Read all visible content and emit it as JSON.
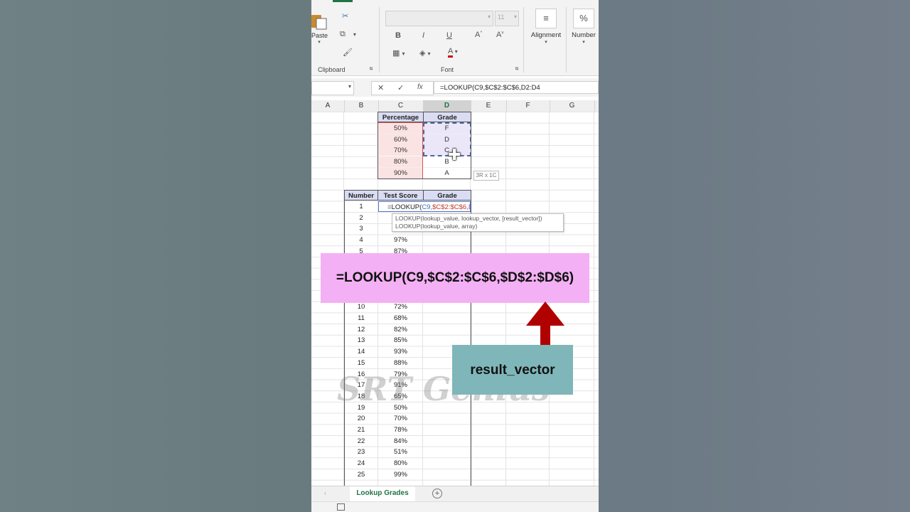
{
  "ribbon": {
    "clipboard_label": "Clipboard",
    "paste_label": "Paste",
    "font_label": "Font",
    "font_size": "11",
    "bold": "B",
    "italic": "I",
    "underline": "U",
    "alignment_label": "Alignment",
    "number_label": "Number",
    "percent_symbol": "%"
  },
  "formula_bar": {
    "formula": "=LOOKUP(C9,$C$2:$C$6,D2:D4"
  },
  "columns": [
    "A",
    "B",
    "C",
    "D",
    "E",
    "F",
    "G"
  ],
  "lookup_table": {
    "headers": [
      "Percentage",
      "Grade"
    ],
    "percentages": [
      "50%",
      "60%",
      "70%",
      "80%",
      "90%"
    ],
    "grades": [
      "F",
      "D",
      "C",
      "B",
      "A"
    ],
    "selection_hint": "3R x 1C"
  },
  "score_table": {
    "headers": [
      "Number",
      "Test Score",
      "Grade"
    ],
    "edit_cell": {
      "prefix": "=LOOKUP(",
      "arg1": "C9,",
      "arg2": "$C$2:$C$6,",
      "arg3": "D2:D4"
    },
    "tooltip": {
      "line1": "LOOKUP(lookup_value, lookup_vector, [result_vector])",
      "line2": "LOOKUP(lookup_value, array)"
    },
    "rows_top": [
      {
        "n": "1",
        "s": ""
      },
      {
        "n": "2",
        "s": ""
      },
      {
        "n": "3",
        "s": ""
      },
      {
        "n": "4",
        "s": "97%"
      },
      {
        "n": "5",
        "s": "87%"
      }
    ],
    "rows_bottom": [
      {
        "n": "10",
        "s": "72%"
      },
      {
        "n": "11",
        "s": "68%"
      },
      {
        "n": "12",
        "s": "82%"
      },
      {
        "n": "13",
        "s": "85%"
      },
      {
        "n": "14",
        "s": "93%"
      },
      {
        "n": "15",
        "s": "88%"
      },
      {
        "n": "16",
        "s": "79%"
      },
      {
        "n": "17",
        "s": "91%"
      },
      {
        "n": "18",
        "s": "65%"
      },
      {
        "n": "19",
        "s": "50%"
      },
      {
        "n": "20",
        "s": "70%"
      },
      {
        "n": "21",
        "s": "78%"
      },
      {
        "n": "22",
        "s": "84%"
      },
      {
        "n": "23",
        "s": "51%"
      },
      {
        "n": "24",
        "s": "80%"
      },
      {
        "n": "25",
        "s": "99%"
      }
    ]
  },
  "sheet_tab": "Lookup Grades",
  "overlay": {
    "banner_text": "=LOOKUP(C9,$C$2:$C$6,$D$2:$D$6)",
    "callout_text": "result_vector",
    "watermark": "SRT Genius"
  },
  "colors": {
    "excel_green": "#217346",
    "banner_pink": "#f4b0f4",
    "callout_teal": "#7fb6b9",
    "arrow_red": "#b00000"
  }
}
